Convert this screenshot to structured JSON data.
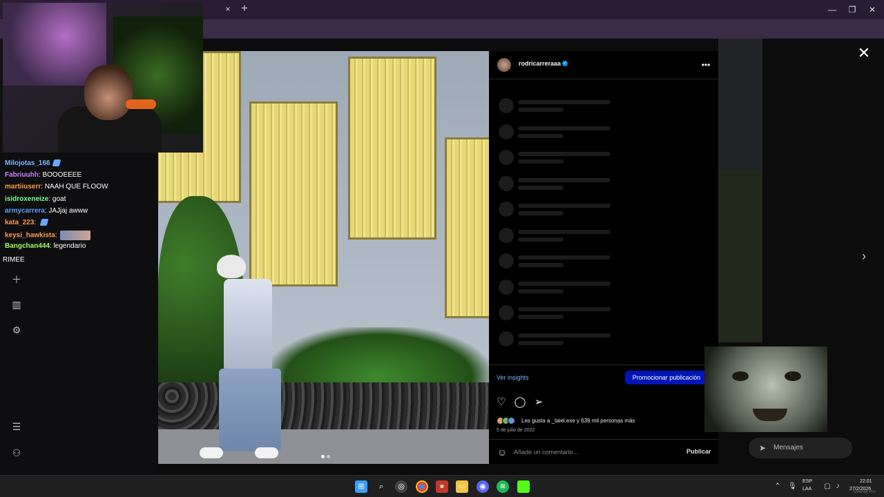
{
  "browser": {
    "tab_close": "×",
    "tab_new": "+",
    "minimize": "—",
    "restore": "❐",
    "close": "✕"
  },
  "post": {
    "username": "rodricarreraaa",
    "verified_glyph": "✓",
    "more_glyph": "•••",
    "insights_label": "Ver insights",
    "promote_label": "Promocionar publicación",
    "likes_text": "Les gusta a _taiel.exe y 639 mil personas más",
    "date": "5 de julio de 2022",
    "comment_placeholder": "Añade un comentario...",
    "publish_label": "Publicar",
    "close_glyph": "✕",
    "next_glyph": "›",
    "skeleton_rows": 10
  },
  "chat": {
    "messages": [
      {
        "user": "Milojotas_166",
        "text": "",
        "color": "#7fb6ff",
        "emote": true
      },
      {
        "user": "Fabriuuhh",
        "text": ": BOOOEEEE",
        "color": "#c77dff",
        "emote": false
      },
      {
        "user": "martiiuserr",
        "text": ": NAAH QUE FLOOW",
        "color": "#ff9a4d",
        "emote": false
      },
      {
        "user": "isidroxeneize",
        "text": ": goat",
        "color": "#7dff8a",
        "emote": false
      },
      {
        "user": "armycarrera",
        "text": ": JAJjaj awww",
        "color": "#5aa0ff",
        "emote": false
      },
      {
        "user": "kata_223",
        "text": ": ",
        "color": "#ff9a4d",
        "emote": true
      },
      {
        "user": "keysi_hawkista",
        "text": ": ",
        "color": "#ff9a4d",
        "emote_img": true
      },
      {
        "user": "Bangchan444",
        "text": ": legendario",
        "color": "#9dff5a",
        "emote": false
      }
    ],
    "trailing_text": "RIMEE"
  },
  "messages_widget": {
    "label": "Mensajes"
  },
  "taskbar": {
    "lang_top": "ESP",
    "lang_bottom": "LAA",
    "time": "22:01",
    "date": "27/2/2026",
    "overlay_watermark": "Overlay Pro"
  },
  "colors": {
    "promote_bg": "#0015b8",
    "insights": "#7fb3ff",
    "verified": "#0095f6"
  }
}
